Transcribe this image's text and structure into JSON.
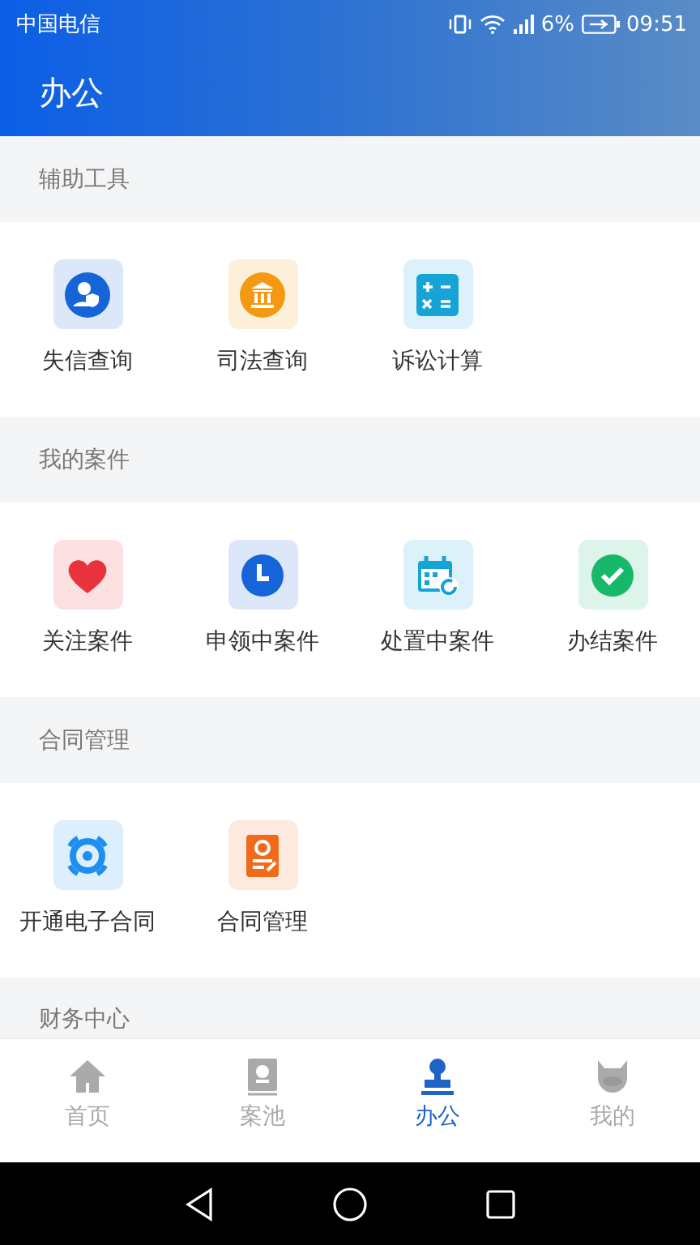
{
  "status_bar": {
    "carrier": "中国电信",
    "battery": "6%",
    "time": "09:51"
  },
  "header": {
    "title": "办公"
  },
  "sections": [
    {
      "title": "辅助工具",
      "items": [
        {
          "label": "失信查询",
          "color": "#1565d8"
        },
        {
          "label": "司法查询",
          "color": "#f39a12"
        },
        {
          "label": "诉讼计算",
          "color": "#16a3d6"
        }
      ]
    },
    {
      "title": "我的案件",
      "items": [
        {
          "label": "关注案件",
          "color": "#e8323c"
        },
        {
          "label": "申领中案件",
          "color": "#1565d8"
        },
        {
          "label": "处置中案件",
          "color": "#16a3d6"
        },
        {
          "label": "办结案件",
          "color": "#18b86a"
        }
      ]
    },
    {
      "title": "合同管理",
      "items": [
        {
          "label": "开通电子合同",
          "color": "#1e8ef0"
        },
        {
          "label": "合同管理",
          "color": "#f06a1a"
        }
      ]
    },
    {
      "title": "财务中心"
    }
  ],
  "tabs": [
    {
      "label": "首页",
      "selected": false
    },
    {
      "label": "案池",
      "selected": false
    },
    {
      "label": "办公",
      "selected": true
    },
    {
      "label": "我的",
      "selected": false
    }
  ]
}
